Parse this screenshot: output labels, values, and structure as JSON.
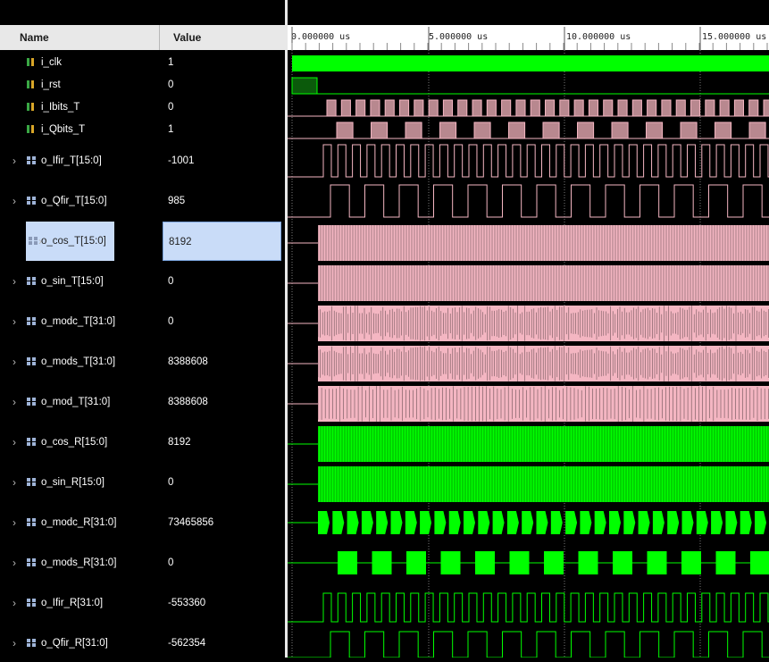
{
  "columns": {
    "name": "Name",
    "value": "Value"
  },
  "time_labels": [
    "0.000000 us",
    "5.000000 us",
    "10.000000 us",
    "15.000000 us"
  ],
  "signals": [
    {
      "name": "i_clk",
      "value": "1",
      "kind": "bit",
      "expandable": false
    },
    {
      "name": "i_rst",
      "value": "0",
      "kind": "bit",
      "expandable": false
    },
    {
      "name": "i_Ibits_T",
      "value": "0",
      "kind": "bit",
      "expandable": false
    },
    {
      "name": "i_Qbits_T",
      "value": "1",
      "kind": "bit",
      "expandable": false
    },
    {
      "name": "o_Ifir_T[15:0]",
      "value": "-1001",
      "kind": "bus",
      "expandable": true
    },
    {
      "name": "o_Qfir_T[15:0]",
      "value": "985",
      "kind": "bus",
      "expandable": true
    },
    {
      "name": "o_cos_T[15:0]",
      "value": "8192",
      "kind": "bus",
      "expandable": true,
      "selected": true
    },
    {
      "name": "o_sin_T[15:0]",
      "value": "0",
      "kind": "bus",
      "expandable": true
    },
    {
      "name": "o_modc_T[31:0]",
      "value": "0",
      "kind": "bus",
      "expandable": true
    },
    {
      "name": "o_mods_T[31:0]",
      "value": "8388608",
      "kind": "bus",
      "expandable": true
    },
    {
      "name": "o_mod_T[31:0]",
      "value": "8388608",
      "kind": "bus",
      "expandable": true
    },
    {
      "name": "o_cos_R[15:0]",
      "value": "8192",
      "kind": "bus",
      "expandable": true
    },
    {
      "name": "o_sin_R[15:0]",
      "value": "0",
      "kind": "bus",
      "expandable": true
    },
    {
      "name": "o_modc_R[31:0]",
      "value": "73465856",
      "kind": "bus",
      "expandable": true
    },
    {
      "name": "o_mods_R[31:0]",
      "value": "0",
      "kind": "bus",
      "expandable": true
    },
    {
      "name": "o_Ifir_R[31:0]",
      "value": "-553360",
      "kind": "bus",
      "expandable": true
    },
    {
      "name": "o_Qfir_R[31:0]",
      "value": "-562354",
      "kind": "bus",
      "expandable": true
    }
  ],
  "colors": {
    "green": "#00ff00",
    "pink": "#f4b6c2",
    "grid": "#7a7a7a",
    "selection": "#c9dcf8"
  }
}
